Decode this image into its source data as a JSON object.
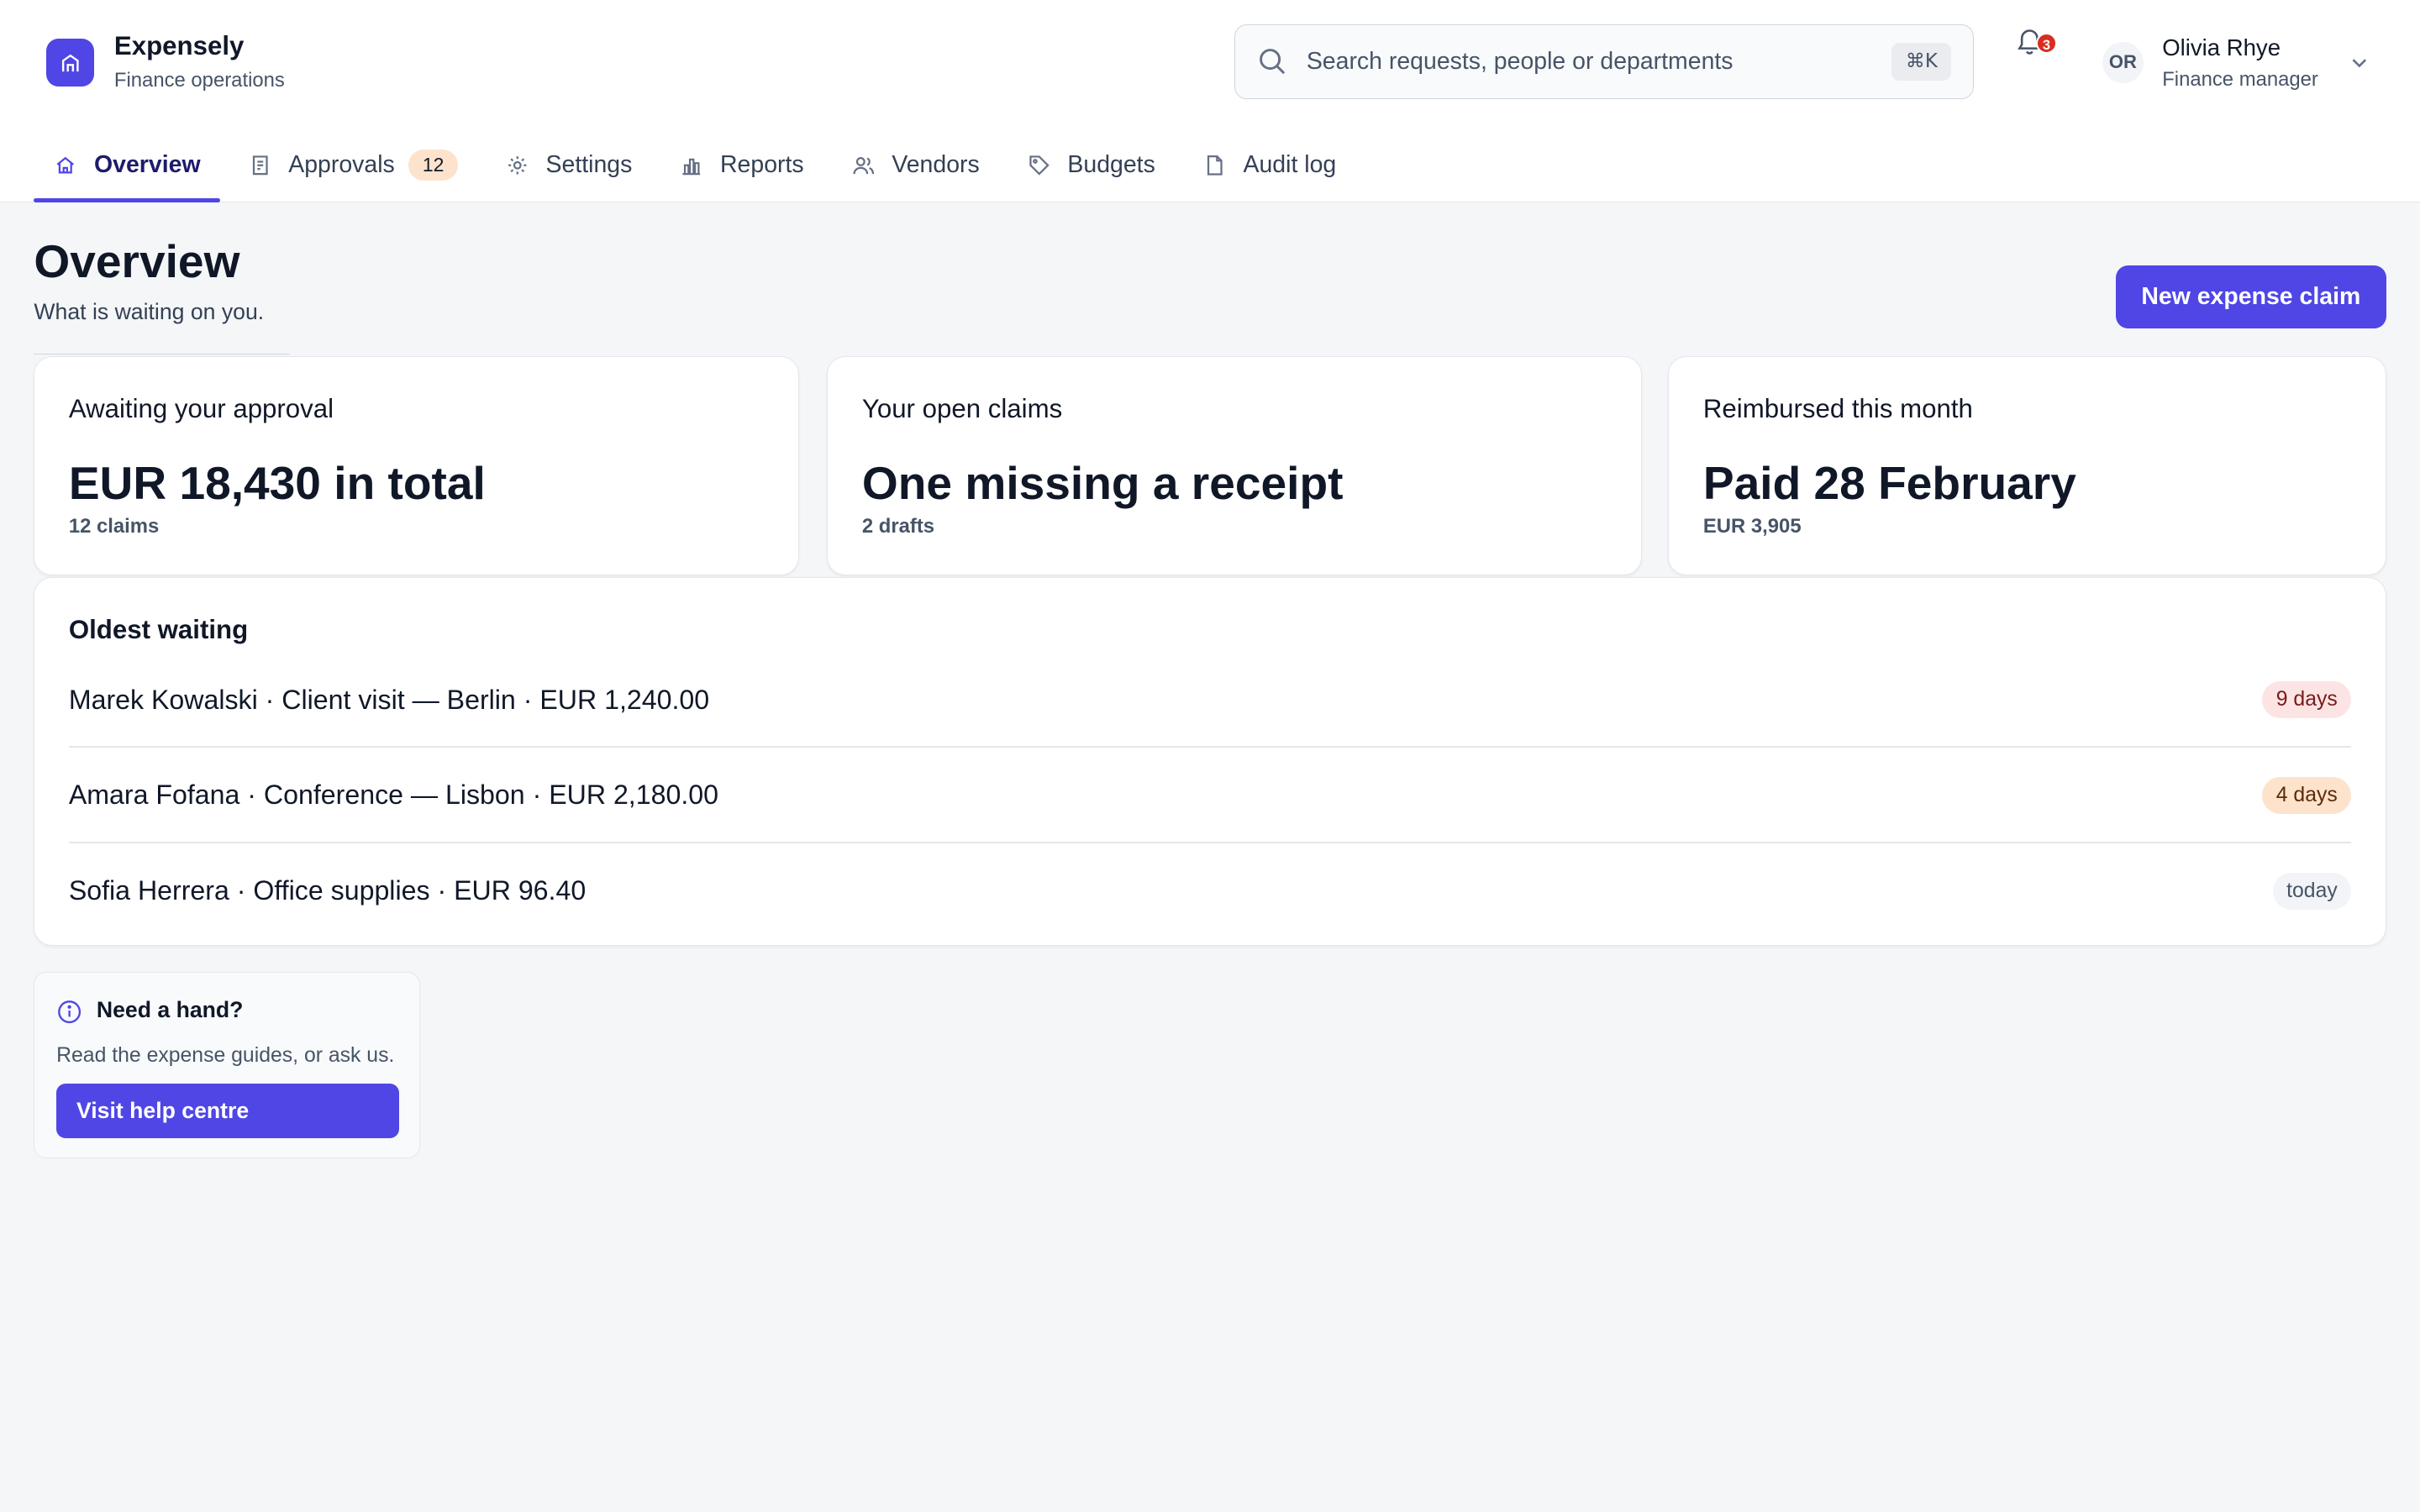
{
  "brand": {
    "name": "Expensely",
    "subtitle": "Finance operations"
  },
  "search": {
    "placeholder": "Search requests, people or departments",
    "shortcut": "⌘K"
  },
  "notifications": {
    "count": "3"
  },
  "user": {
    "initials": "OR",
    "name": "Olivia Rhye",
    "role": "Finance manager"
  },
  "tabs": [
    {
      "label": "Overview",
      "icon": "home-icon",
      "active": true
    },
    {
      "label": "Approvals",
      "icon": "receipt-icon",
      "count": "12"
    },
    {
      "label": "Settings",
      "icon": "gear-icon"
    },
    {
      "label": "Reports",
      "icon": "bar-chart-icon"
    },
    {
      "label": "Vendors",
      "icon": "users-icon"
    },
    {
      "label": "Budgets",
      "icon": "tag-icon"
    },
    {
      "label": "Audit log",
      "icon": "document-icon"
    }
  ],
  "page": {
    "title": "Overview",
    "subtitle": "What is waiting on you.",
    "primary_action": "New expense claim"
  },
  "stats": [
    {
      "label": "Awaiting your approval",
      "value": "EUR 18,430 in total",
      "meta": "12 claims"
    },
    {
      "label": "Your open claims",
      "value": "One missing a receipt",
      "meta": "2 drafts"
    },
    {
      "label": "Reimbursed this month",
      "value": "Paid 28 February",
      "meta": "EUR 3,905"
    }
  ],
  "oldest_waiting": {
    "title": "Oldest waiting",
    "rows": [
      {
        "text": "Marek Kowalski · Client visit — Berlin · EUR 1,240.00",
        "age": "9 days",
        "tone": "red"
      },
      {
        "text": "Amara Fofana · Conference — Lisbon · EUR 2,180.00",
        "age": "4 days",
        "tone": "orange"
      },
      {
        "text": "Sofia Herrera · Office supplies · EUR 96.40",
        "age": "today",
        "tone": "grey"
      }
    ]
  },
  "help": {
    "title": "Need a hand?",
    "text": "Read the expense guides, or ask us.",
    "button": "Visit help centre"
  },
  "colors": {
    "accent": "#4f46e5",
    "danger": "#d92d20",
    "background": "#f5f6f8"
  }
}
